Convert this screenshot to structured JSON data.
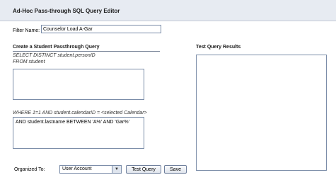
{
  "header": {
    "title": "Ad-Hoc Pass-through SQL Query Editor"
  },
  "filter": {
    "label": "Filter Name:",
    "value": "Counselor Load A-Gar"
  },
  "left_panel": {
    "heading": "Create a Student Passthrough Query",
    "select_line": "SELECT DISTINCT student.personID",
    "from_line": "FROM student",
    "from_box_value": "",
    "where_line": "WHERE 1=1 AND student.calendarID = <selected Calendar>",
    "where_box_value": "AND student.lastname BETWEEN 'A%' AND 'Gar%'"
  },
  "right_panel": {
    "heading": "Test Query Results",
    "results": ""
  },
  "footer": {
    "organized_label": "Organized To:",
    "organized_value": "User Account",
    "test_query_label": "Test Query",
    "save_label": "Save"
  }
}
